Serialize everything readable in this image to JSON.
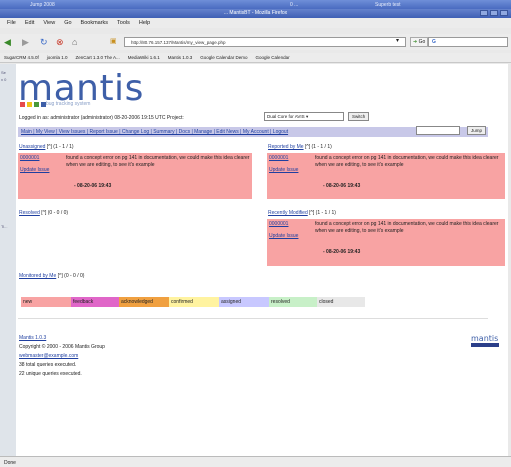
{
  "window": {
    "prev_strip": [
      "Jump 2008",
      "0 ...",
      "Superb test"
    ],
    "title": "... MantisBT - Mozilla Firefox"
  },
  "menubar": [
    "File",
    "Edit",
    "View",
    "Go",
    "Bookmarks",
    "Tools",
    "Help"
  ],
  "toolbar": {
    "url": "http://80.76.157.137/Mantis/my_view_page.php",
    "go_label": "Go",
    "search_engine": "G"
  },
  "bookmarks": [
    "SugarCRM 4.5.0f",
    "joomla 1.0",
    "ZenCart 1.3.0 The A...",
    "MediaWiki 1.6.1",
    "Mantis 1.0.3",
    "Google Calendar Demo",
    "Google Calendar"
  ],
  "left_edge": [
    "Se",
    "x 0",
    "Ti..."
  ],
  "logo": {
    "word": "mantis",
    "tagline": "bug tracking system",
    "dots": [
      "#e64b4b",
      "#f0c419",
      "#4a9a3a",
      "#3e5fa8"
    ]
  },
  "login": {
    "text": "Logged in as: administrator (administrator) 08-20-2006 19:15 UTC Project:",
    "project": "Dual Core for AVIS",
    "switch": "Switch"
  },
  "nav": {
    "text": "Main | My View | View Issues | Report Issue | Change Log | Summary | Docs | Manage | Edit News | My Account | Logout",
    "jump": "Jump"
  },
  "boxes": {
    "unassigned": {
      "title": "Unassigned",
      "count": "[^] (1 - 1 / 1)",
      "id": "0000001",
      "update": "Update Issue",
      "text": "found a concept error on pg 141 in documentation, we could make this idea clearer when we are editing, to see it's example",
      "date": "- 08-20-06 19:43"
    },
    "reported": {
      "title": "Reported by Me",
      "count": "[^] (1 - 1 / 1)",
      "id": "0000001",
      "update": "Update Issue",
      "text": "found a concept error on pg 141 in documentation, we could make this idea clearer when we are editing, to see it's example",
      "date": "- 08-20-06 19:43"
    },
    "resolved": {
      "title": "Resolved",
      "count": "[^] (0 - 0 / 0)"
    },
    "modified": {
      "title": "Recently Modified",
      "count": "[^] (1 - 1 / 1)",
      "id": "0000001",
      "update": "Update Issue",
      "text": "found a concept error on pg 141 in documentation, we could make this idea clearer when we are editing, to see it's example",
      "date": "- 08-20-06 19:43"
    },
    "monitored": {
      "title": "Monitored by Me",
      "count": "[^] (0 - 0 / 0)"
    }
  },
  "legend": [
    {
      "label": "new",
      "color": "#f8a3a3"
    },
    {
      "label": "feedback",
      "color": "#e066c8"
    },
    {
      "label": "acknowledged",
      "color": "#f0a040"
    },
    {
      "label": "confirmed",
      "color": "#fff3a0"
    },
    {
      "label": "assigned",
      "color": "#c8c8ff"
    },
    {
      "label": "resolved",
      "color": "#c8f0c8"
    },
    {
      "label": "closed",
      "color": "#e8e8e8"
    }
  ],
  "footer": {
    "version": "Mantis 1.0.3",
    "copyright": "Copyright © 2000 - 2006 Mantis Group",
    "email": "webmaster@example.com",
    "queries_executed": "38 total queries executed.",
    "unique_queries": "22 unique queries executed."
  },
  "status": "Done"
}
